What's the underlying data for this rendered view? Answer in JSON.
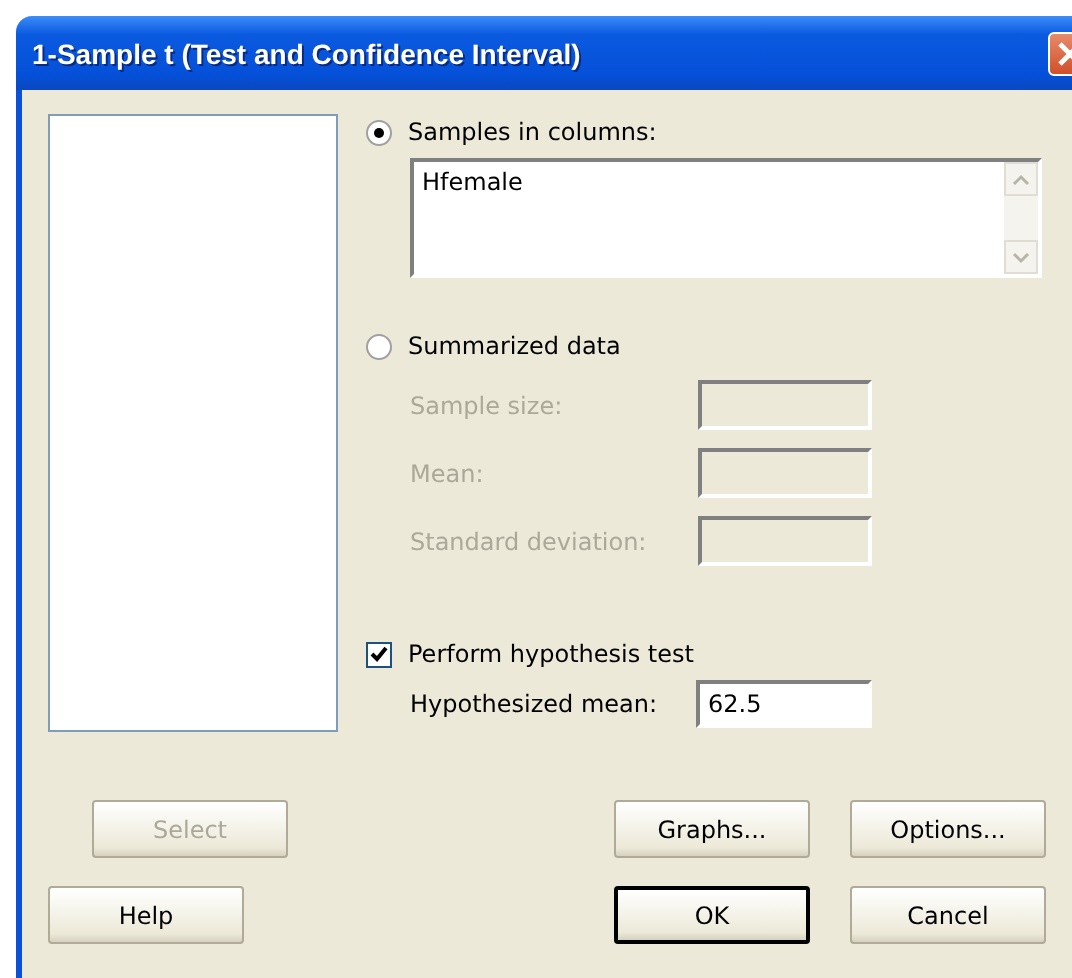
{
  "window": {
    "title": "1-Sample t (Test and Confidence Interval)"
  },
  "samples_in_columns": {
    "label": "Samples in columns:",
    "selected": true,
    "value": "Hfemale"
  },
  "summarized_data": {
    "label": "Summarized data",
    "selected": false,
    "fields": [
      {
        "label": "Sample size:",
        "disabled": true
      },
      {
        "label": "Mean:",
        "disabled": true
      },
      {
        "label": "Standard deviation:",
        "disabled": true
      }
    ]
  },
  "hypothesis_test": {
    "label": "Perform hypothesis test",
    "checked": true,
    "field_label": "Hypothesized mean:",
    "value": "62.5"
  },
  "button_rows": [
    [
      {
        "label": "Select",
        "disabled": true,
        "default": false
      },
      {
        "label": "Graphs...",
        "disabled": false,
        "default": false
      },
      {
        "label": "Options...",
        "disabled": false,
        "default": false
      }
    ],
    [
      {
        "label": "Help",
        "disabled": false,
        "default": false
      },
      {
        "label": "OK",
        "disabled": false,
        "default": true
      },
      {
        "label": "Cancel",
        "disabled": false,
        "default": false
      }
    ]
  ]
}
